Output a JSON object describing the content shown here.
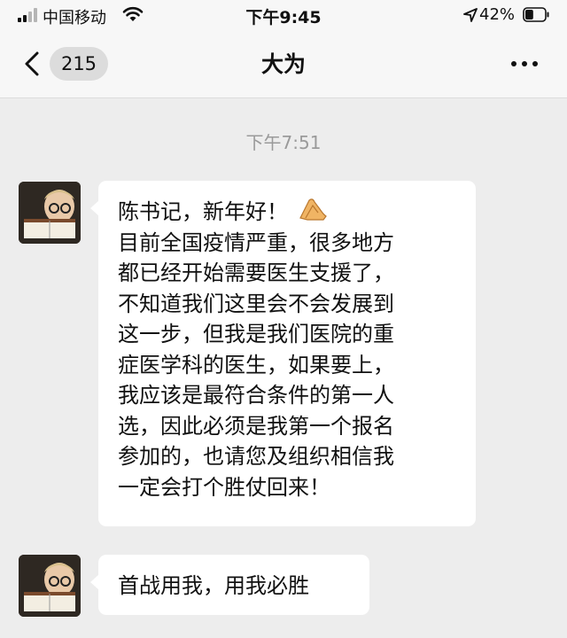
{
  "status_bar": {
    "carrier": "中国移动",
    "time": "下午9:45",
    "battery_percent": "42%",
    "battery_level": 0.42,
    "icons": [
      "signal-icon",
      "wifi-icon",
      "location-arrow-icon",
      "battery-icon"
    ]
  },
  "nav": {
    "back_icon": "chevron-left-icon",
    "unread_count": "215",
    "title": "大为",
    "more_icon": "ellipsis-icon"
  },
  "chat": {
    "timestamp": "下午7:51",
    "messages": [
      {
        "lines": [
          "陈书记，新年好！",
          "目前全国疫情严重，很多地方",
          "都已经开始需要医生支援了，",
          "不知道我们这里会不会发展到",
          "这一步，但我是我们医院的重",
          "症医学科的医生，如果要上，",
          "我应该是最符合条件的第一人",
          "选，因此必须是我第一个报名",
          "参加的，也请您及组织相信我",
          "一定会打个胜仗回来！"
        ],
        "emoji": "praying-hands-emoji"
      },
      {
        "lines": [
          "首战用我，用我必胜"
        ]
      }
    ]
  },
  "colors": {
    "background": "#ededed",
    "bar": "#f7f7f7",
    "bubble": "#ffffff",
    "timestamp": "#9a9a9a"
  }
}
